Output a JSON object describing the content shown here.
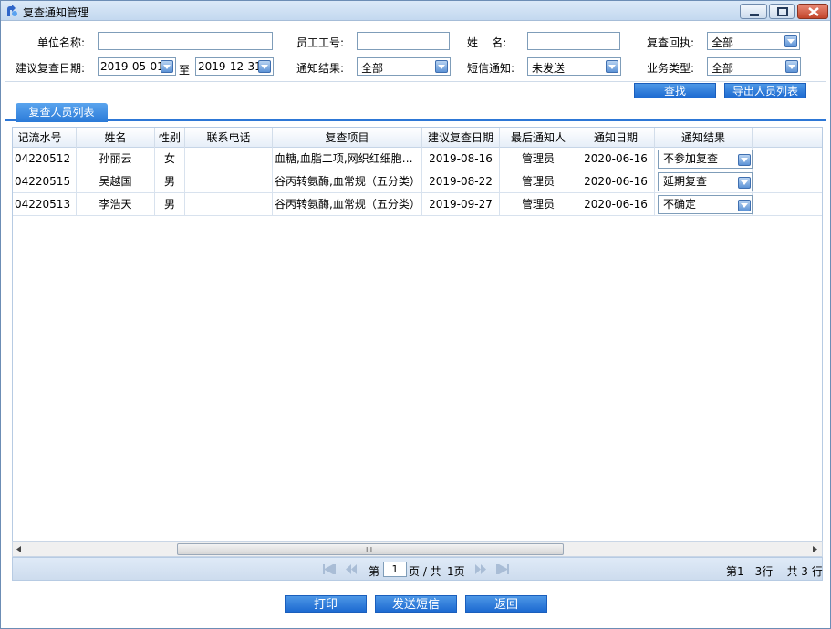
{
  "window": {
    "title": "复查通知管理"
  },
  "filters": {
    "unit_label": "单位名称:",
    "unit_value": "",
    "emp_label": "员工工号:",
    "emp_value": "",
    "name_label": "姓    名:",
    "name_value": "",
    "reply_label": "复查回执:",
    "reply_value": "全部",
    "date_label": "建议复查日期:",
    "date_from": "2019-05-01",
    "date_to_label": "至",
    "date_to": "2019-12-31",
    "result_label": "通知结果:",
    "result_value": "全部",
    "sms_label": "短信通知:",
    "sms_value": "未发送",
    "biz_label": "业务类型:",
    "biz_value": "全部"
  },
  "actions": {
    "search": "查找",
    "export": "导出人员列表"
  },
  "tabs": [
    {
      "label": "复查人员列表"
    }
  ],
  "table": {
    "columns": [
      "记流水号",
      "姓名",
      "性别",
      "联系电话",
      "复查项目",
      "建议复查日期",
      "最后通知人",
      "通知日期",
      "通知结果"
    ],
    "rows": [
      {
        "serial": "04220512",
        "name": "孙丽云",
        "gender": "女",
        "phone": "",
        "items": "血糖,血脂二项,网织红细胞…",
        "suggest_date": "2019-08-16",
        "notifier": "管理员",
        "notice_date": "2020-06-16",
        "result": "不参加复查"
      },
      {
        "serial": "04220515",
        "name": "吴越国",
        "gender": "男",
        "phone": "",
        "items": "谷丙转氨酶,血常规（五分类）",
        "suggest_date": "2019-08-22",
        "notifier": "管理员",
        "notice_date": "2020-06-16",
        "result": "延期复查"
      },
      {
        "serial": "04220513",
        "name": "李浩天",
        "gender": "男",
        "phone": "",
        "items": "谷丙转氨酶,血常规（五分类）",
        "suggest_date": "2019-09-27",
        "notifier": "管理员",
        "notice_date": "2020-06-16",
        "result": "不确定"
      }
    ]
  },
  "scrollbar": {
    "grip": "III"
  },
  "pager": {
    "page_prefix": "第",
    "page_value": "1",
    "page_mid": "页 / 共",
    "total_pages": "1页",
    "summary": "第1 - 3行    共 3 行"
  },
  "bottom": {
    "print": "打印",
    "send_sms": "发送短信",
    "back": "返回"
  },
  "colors": {
    "accent": "#2d77d6",
    "button": "#1d6ad1"
  }
}
